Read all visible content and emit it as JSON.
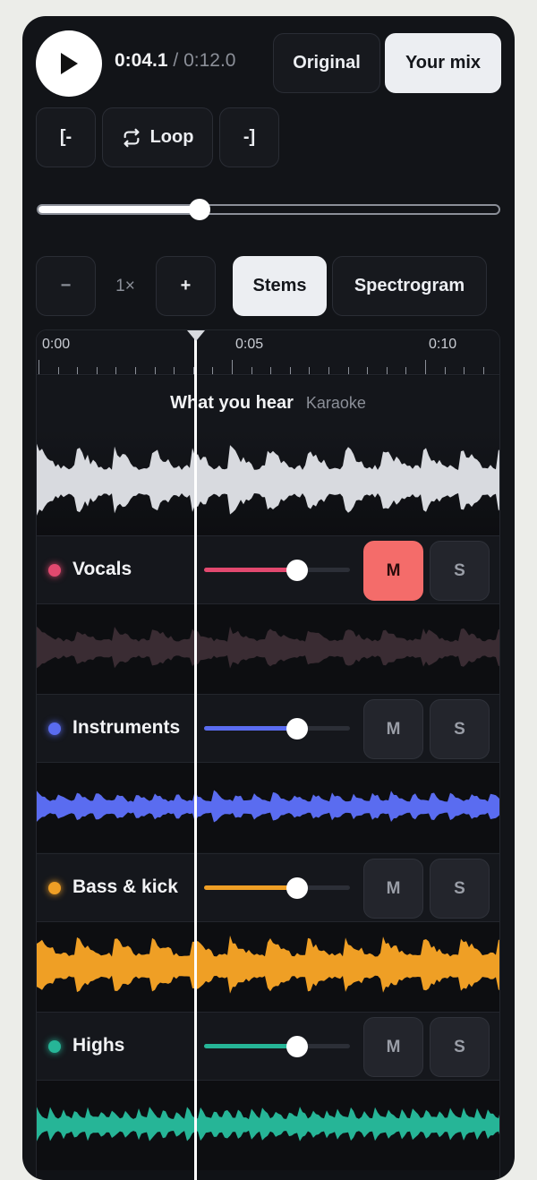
{
  "transport": {
    "current_time": "0:04.1",
    "separator": "/",
    "total_time": "0:12.0",
    "progress": 0.35
  },
  "mode_toggle": {
    "original_label": "Original",
    "mix_label": "Your mix",
    "selected": "Your mix"
  },
  "loop_controls": {
    "set_start_label": "[-",
    "loop_label": "Loop",
    "set_end_label": "-]"
  },
  "zoom": {
    "minus_label": "−",
    "value": "1×",
    "plus_label": "+"
  },
  "view_toggle": {
    "stems_label": "Stems",
    "spectrogram_label": "Spectrogram",
    "selected": "Stems"
  },
  "ruler": {
    "labels": [
      "0:00",
      "0:05",
      "0:10"
    ]
  },
  "mix_track": {
    "title": "What you hear",
    "subtitle": "Karaoke",
    "color": "#d8dadf"
  },
  "stems": [
    {
      "name": "Vocals",
      "color": "#e2496f",
      "volume": 0.64,
      "mute_label": "M",
      "solo_label": "S",
      "muted": true
    },
    {
      "name": "Instruments",
      "color": "#5a6cf0",
      "volume": 0.64,
      "mute_label": "M",
      "solo_label": "S",
      "muted": false
    },
    {
      "name": "Bass & kick",
      "color": "#ef9f25",
      "volume": 0.64,
      "mute_label": "M",
      "solo_label": "S",
      "muted": false
    },
    {
      "name": "Highs",
      "color": "#26b597",
      "volume": 0.64,
      "mute_label": "M",
      "solo_label": "S",
      "muted": false
    }
  ],
  "icons": {
    "play": "play-icon",
    "loop": "loop-icon",
    "playhead": "playhead-marker-icon"
  }
}
